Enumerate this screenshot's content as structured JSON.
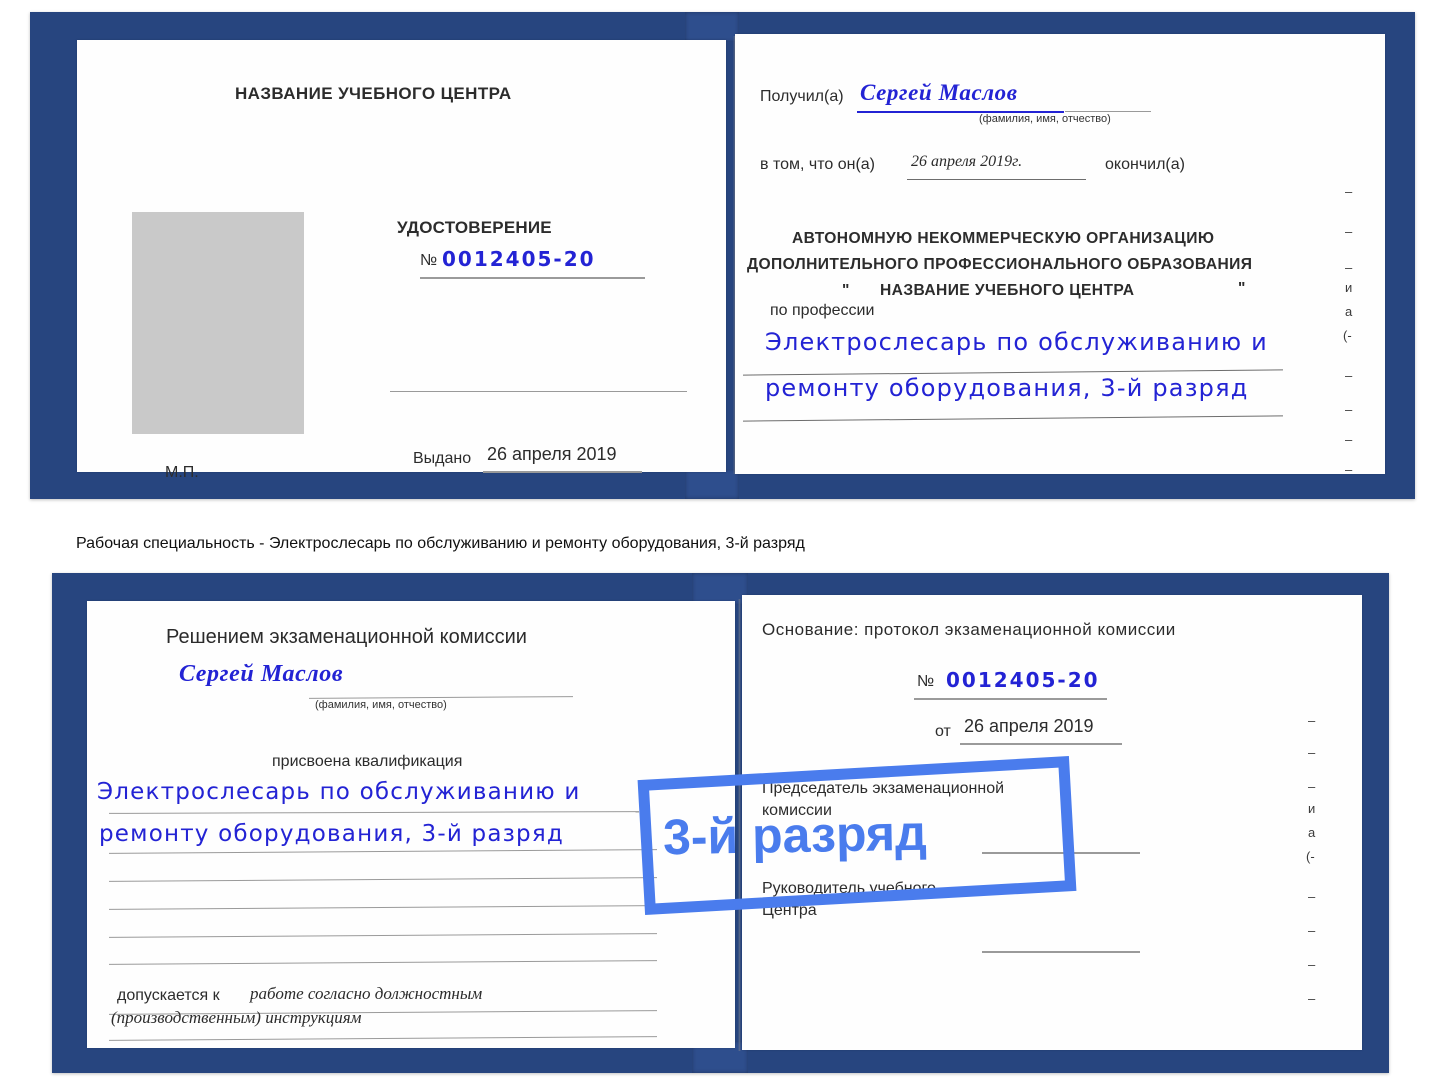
{
  "document": {
    "type": "certificate",
    "kind": "Удостоверение"
  },
  "cert_top": {
    "left_page": {
      "header": "НАЗВАНИЕ УЧЕБНОГО ЦЕНТРА",
      "title": "УДОСТОВЕРЕНИЕ",
      "number_prefix": "№",
      "number_value": "0012405-20",
      "issued_label": "Выдано",
      "issued_value": "26 апреля 2019",
      "seal_label": "М.П.",
      "photo_placeholder": "photo-placeholder"
    },
    "right_page": {
      "received_label": "Получил(а)",
      "received_value": "Сергей Маслов",
      "name_hint": "(фамилия, имя, отчество)",
      "in_that_label": "в том, что он(а)",
      "in_that_value": "26 апреля 2019г.",
      "finished_label": "окончил(а)",
      "org_line1": "АВТОНОМНУЮ НЕКОММЕРЧЕСКУЮ ОРГАНИЗАЦИЮ",
      "org_line2": "ДОПОЛНИТЕЛЬНОГО ПРОФЕССИОНАЛЬНОГО ОБРАЗОВАНИЯ",
      "org_quote_open": "\"",
      "org_line3": "НАЗВАНИЕ УЧЕБНОГО ЦЕНТРА",
      "org_quote_close": "\"",
      "profession_label": "по профессии",
      "profession_line1": "Электрослесарь по обслуживанию и",
      "profession_line2": "ремонту оборудования, 3-й разряд"
    },
    "edge_fragments": [
      "–",
      "–",
      "–",
      "и",
      "а",
      "(-",
      "–",
      "–",
      "–",
      "–"
    ]
  },
  "caption": {
    "text": "Рабочая специальность - Электрослесарь по обслуживанию и ремонту оборудования, 3-й разряд"
  },
  "cert_bottom": {
    "left_page": {
      "header": "Решением экзаменационной комиссии",
      "name_value": "Сергей Маслов",
      "name_hint": "(фамилия, имя, отчество)",
      "qualification_label": "присвоена квалификация",
      "qualification_line1": "Электрослесарь по обслуживанию и",
      "qualification_line2": "ремонту оборудования, 3-й разряд",
      "admitted_label": "допускается к",
      "admitted_line1": "работе согласно должностным",
      "admitted_line2": "(производственным) инструкциям"
    },
    "right_page": {
      "basis_label": "Основание: протокол экзаменационной комиссии",
      "number_prefix": "№",
      "number_value": "0012405-20",
      "date_prefix": "от",
      "date_value": "26 апреля 2019",
      "chairman_line1": "Председатель экзаменационной",
      "chairman_line2": "комиссии",
      "head_line1": "Руководитель учебного",
      "head_line2": "Центра"
    },
    "edge_fragments": [
      "–",
      "–",
      "–",
      "и",
      "а",
      "(-",
      "–",
      "–",
      "–",
      "–"
    ]
  },
  "badge": {
    "text": "3-й разряд",
    "color": "#4a7ced"
  },
  "colors": {
    "cover_blue": "#27457f",
    "ink_blue": "#2323d4",
    "accent_blue": "#4a7ced",
    "paper": "#fefefe",
    "photo_gray": "#c9c9c9",
    "rule_gray": "#9a9a9a"
  }
}
